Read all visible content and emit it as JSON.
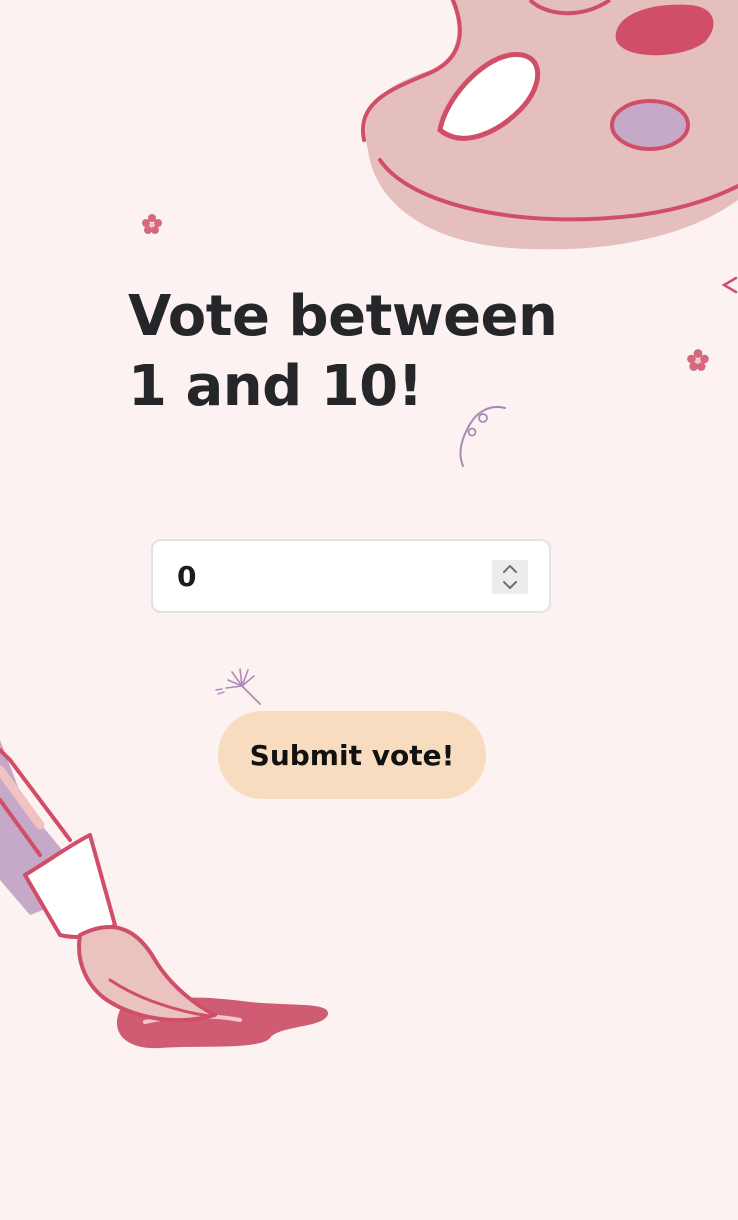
{
  "heading": {
    "text": "Vote between 1 and 10!"
  },
  "vote_input": {
    "value": "0",
    "placeholder": ""
  },
  "submit_button": {
    "label": "Submit vote!"
  },
  "icons": {
    "stepper_up": "chevron-up-icon",
    "stepper_down": "chevron-down-icon",
    "decorations": [
      "paint-palette-icon",
      "paintbrush-icon",
      "flower-icon",
      "swirl-icon",
      "dandelion-icon"
    ]
  },
  "colors": {
    "background": "#fbf2f1",
    "heading": "#24262a",
    "button": "#f8dcc0",
    "palette": "#e4bfbd",
    "accent": "#d04e68",
    "lavender": "#c6a9c9"
  }
}
